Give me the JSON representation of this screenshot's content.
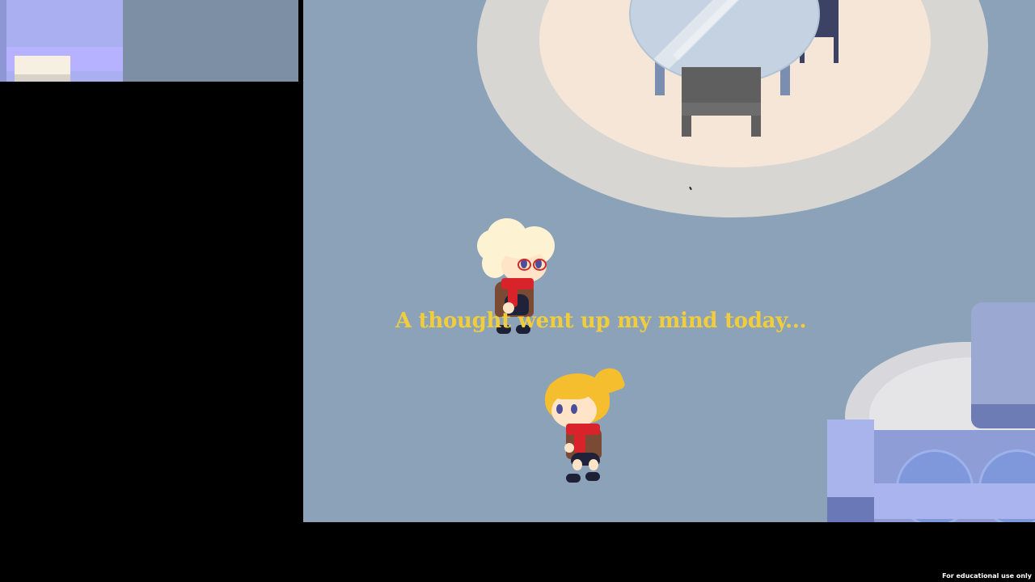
{
  "scene": {
    "dialogue_text": "A thought went up my mind today...",
    "watermark": "For educational use only"
  },
  "colors": {
    "background": "#000000",
    "floor": "#8ca2b9",
    "dialogue": "#f1cd3c",
    "rug_outer": "#d8d6d2",
    "rug_inner": "#f6e6d8",
    "sofa": "#9aa8d2"
  },
  "characters": [
    {
      "name": "white-haired-character-with-glasses"
    },
    {
      "name": "blond-character"
    }
  ],
  "icons": [
    "table",
    "chair",
    "sofa",
    "rug"
  ]
}
